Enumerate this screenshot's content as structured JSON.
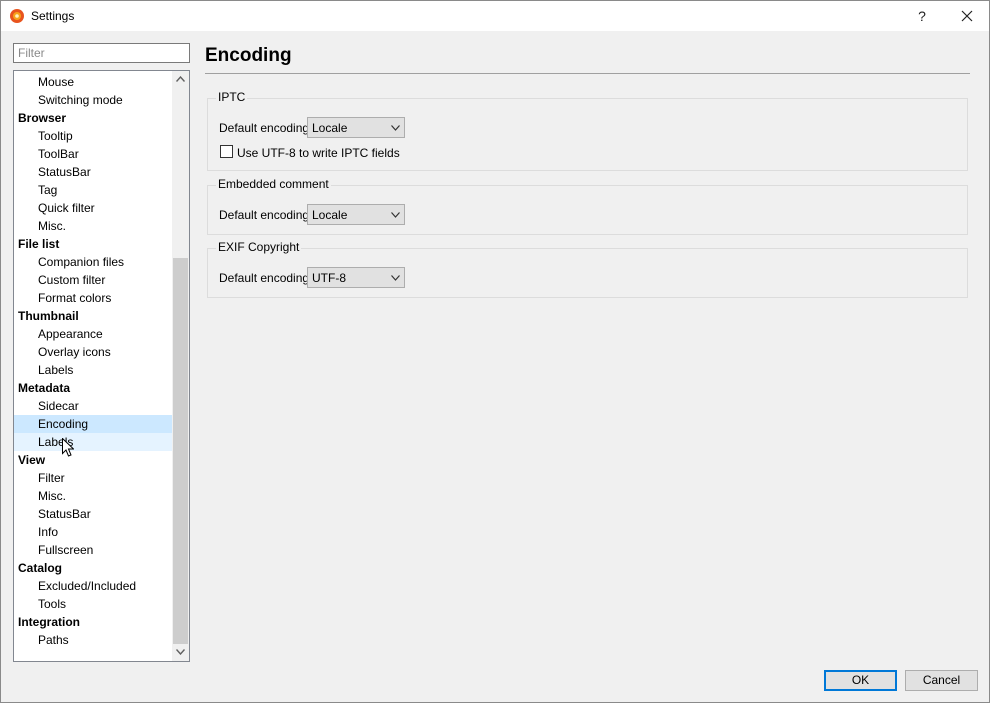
{
  "window": {
    "title": "Settings",
    "help_label": "?"
  },
  "sidebar": {
    "filter_placeholder": "Filter",
    "items": [
      {
        "label": "Mouse",
        "level": "sub"
      },
      {
        "label": "Switching mode",
        "level": "sub"
      },
      {
        "label": "Browser",
        "level": "cat"
      },
      {
        "label": "Tooltip",
        "level": "sub"
      },
      {
        "label": "ToolBar",
        "level": "sub"
      },
      {
        "label": "StatusBar",
        "level": "sub"
      },
      {
        "label": "Tag",
        "level": "sub"
      },
      {
        "label": "Quick filter",
        "level": "sub"
      },
      {
        "label": "Misc.",
        "level": "sub"
      },
      {
        "label": "File list",
        "level": "cat"
      },
      {
        "label": "Companion files",
        "level": "sub"
      },
      {
        "label": "Custom filter",
        "level": "sub"
      },
      {
        "label": "Format colors",
        "level": "sub"
      },
      {
        "label": "Thumbnail",
        "level": "cat"
      },
      {
        "label": "Appearance",
        "level": "sub"
      },
      {
        "label": "Overlay icons",
        "level": "sub"
      },
      {
        "label": "Labels",
        "level": "sub"
      },
      {
        "label": "Metadata",
        "level": "cat"
      },
      {
        "label": "Sidecar",
        "level": "sub"
      },
      {
        "label": "Encoding",
        "level": "sub",
        "state": "selected"
      },
      {
        "label": "Labels",
        "level": "sub",
        "state": "hover"
      },
      {
        "label": "View",
        "level": "cat"
      },
      {
        "label": "Filter",
        "level": "sub"
      },
      {
        "label": "Misc.",
        "level": "sub"
      },
      {
        "label": "StatusBar",
        "level": "sub"
      },
      {
        "label": "Info",
        "level": "sub"
      },
      {
        "label": "Fullscreen",
        "level": "sub"
      },
      {
        "label": "Catalog",
        "level": "cat"
      },
      {
        "label": "Excluded/Included",
        "level": "sub"
      },
      {
        "label": "Tools",
        "level": "sub"
      },
      {
        "label": "Integration",
        "level": "cat"
      },
      {
        "label": "Paths",
        "level": "sub"
      }
    ]
  },
  "main": {
    "title": "Encoding",
    "iptc": {
      "group_label": "IPTC",
      "encoding_label": "Default encoding",
      "encoding_value": "Locale",
      "utf8_checkbox_label": "Use UTF-8 to write IPTC fields",
      "utf8_checked": false
    },
    "embedded_comment": {
      "group_label": "Embedded comment",
      "encoding_label": "Default encoding",
      "encoding_value": "Locale"
    },
    "exif_copyright": {
      "group_label": "EXIF Copyright",
      "encoding_label": "Default encoding",
      "encoding_value": "UTF-8"
    }
  },
  "footer": {
    "ok_label": "OK",
    "cancel_label": "Cancel"
  },
  "colors": {
    "selection": "#cce8ff",
    "hover": "#e5f3ff",
    "default_button_border": "#0078d7"
  }
}
